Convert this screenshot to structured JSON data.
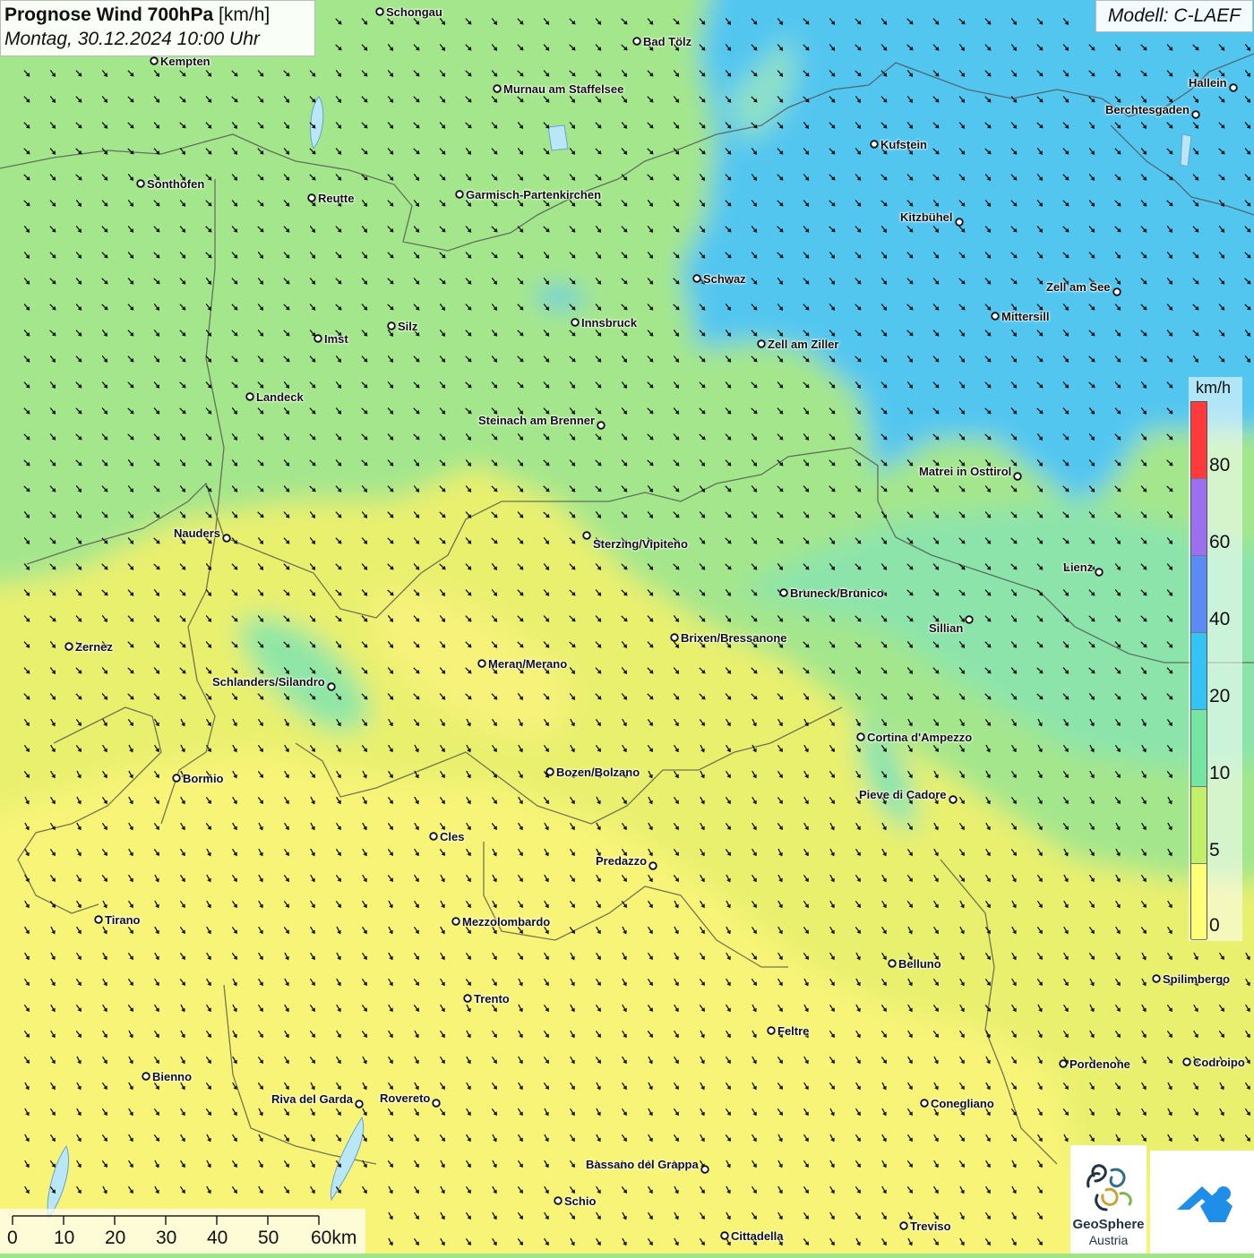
{
  "title": {
    "main": "Prognose Wind 700hPa",
    "unit": "[km/h]",
    "datetime": "Montag, 30.12.2024 10:00 Uhr"
  },
  "model": "Modell: C-LAEF",
  "legend": {
    "unit": "km/h",
    "colors": [
      "#ff3a3a",
      "#9b6ff0",
      "#5b8cf5",
      "#34c3f5",
      "#74e6a2",
      "#c2ef6a",
      "#ffff78"
    ],
    "labels": [
      "80",
      "60",
      "40",
      "20",
      "10",
      "5",
      "0"
    ]
  },
  "scalebar": {
    "labels": [
      "0",
      "10",
      "20",
      "30",
      "40",
      "50",
      "60km"
    ]
  },
  "logos": {
    "geosphere_line1": "GeoSphere",
    "geosphere_line2": "Austria"
  },
  "wind_field": {
    "direction": "north-west to south-east",
    "arrow": "wind-direction-arrow"
  },
  "zones": {
    "strong": "20–40 km/h (north-east)",
    "moderate": "10–20 km/h (north and centre)",
    "weak": "0–10 km/h (south)"
  },
  "cities": [
    "Schongau",
    "Bad Tölz",
    "Kempten",
    "Murnau am Staffelsee",
    "Hallein",
    "Berchtesgaden",
    "Kufstein",
    "Sonthofen",
    "Reutte",
    "Garmisch-Partenkirchen",
    "Kitzbühel",
    "Schwaz",
    "Zell am See",
    "Innsbruck",
    "Mittersill",
    "Silz",
    "Imst",
    "Zell am Ziller",
    "Landeck",
    "Steinach am Brenner",
    "Matrei in Osttirol",
    "Nauders",
    "Sterzing/Vipiteno",
    "Lienz",
    "Bruneck/Brunico",
    "Sillian",
    "Brixen/Bressanone",
    "Zernez",
    "Meran/Merano",
    "Schlanders/Silandro",
    "Cortina d'Ampezzo",
    "Bozen/Bolzano",
    "Bormio",
    "Pieve di Cadore",
    "Cles",
    "Predazzo",
    "Tirano",
    "Mezzolombardo",
    "Belluno",
    "Spilimbergo",
    "Trento",
    "Feltre",
    "Pordenone",
    "Codroipo",
    "Bienno",
    "Riva del Garda",
    "Rovereto",
    "Conegliano",
    "Bassano del Grappa",
    "Schio",
    "Treviso",
    "Cittadella"
  ]
}
